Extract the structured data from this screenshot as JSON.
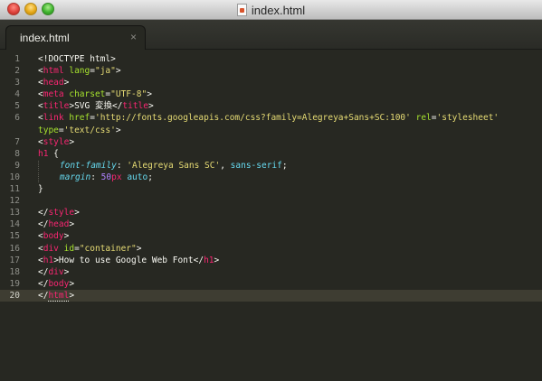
{
  "window": {
    "title": "index.html"
  },
  "tabs": [
    {
      "label": "index.html",
      "close_glyph": "×",
      "active": true
    }
  ],
  "editor": {
    "active_line": 20,
    "lines": [
      {
        "num": "1",
        "segs": [
          [
            "p",
            "<!DOCTYPE html>"
          ]
        ]
      },
      {
        "num": "2",
        "segs": [
          [
            "p",
            "<"
          ],
          [
            "g",
            "html"
          ],
          [
            "p",
            " "
          ],
          [
            "a",
            "lang"
          ],
          [
            "p",
            "="
          ],
          [
            "s",
            "\"ja\""
          ],
          [
            "p",
            ">"
          ]
        ]
      },
      {
        "num": "3",
        "segs": [
          [
            "p",
            "<"
          ],
          [
            "g",
            "head"
          ],
          [
            "p",
            ">"
          ]
        ]
      },
      {
        "num": "4",
        "segs": [
          [
            "p",
            "<"
          ],
          [
            "g",
            "meta"
          ],
          [
            "p",
            " "
          ],
          [
            "a",
            "charset"
          ],
          [
            "p",
            "="
          ],
          [
            "s",
            "\"UTF-8\""
          ],
          [
            "p",
            ">"
          ]
        ]
      },
      {
        "num": "5",
        "segs": [
          [
            "p",
            "<"
          ],
          [
            "g",
            "title"
          ],
          [
            "p",
            ">SVG 変換</"
          ],
          [
            "g",
            "title"
          ],
          [
            "p",
            ">"
          ]
        ]
      },
      {
        "num": "6",
        "segs": [
          [
            "p",
            "<"
          ],
          [
            "g",
            "link"
          ],
          [
            "p",
            " "
          ],
          [
            "a",
            "href"
          ],
          [
            "p",
            "="
          ],
          [
            "s",
            "'http://fonts.googleapis.com/css?family=Alegreya+Sans+SC:100'"
          ],
          [
            "p",
            " "
          ],
          [
            "a",
            "rel"
          ],
          [
            "p",
            "="
          ],
          [
            "s",
            "'stylesheet'"
          ]
        ]
      },
      {
        "num": "",
        "segs": [
          [
            "a",
            "type"
          ],
          [
            "p",
            "="
          ],
          [
            "s",
            "'text/css'"
          ],
          [
            "p",
            ">"
          ]
        ]
      },
      {
        "num": "7",
        "segs": [
          [
            "p",
            "<"
          ],
          [
            "g",
            "style"
          ],
          [
            "p",
            ">"
          ]
        ]
      },
      {
        "num": "8",
        "segs": [
          [
            "g",
            "h1"
          ],
          [
            "p",
            " {"
          ]
        ]
      },
      {
        "num": "9",
        "segs": [
          [
            "i",
            "    "
          ],
          [
            "k",
            "font-family"
          ],
          [
            "p",
            ": "
          ],
          [
            "s",
            "'Alegreya Sans SC'"
          ],
          [
            "p",
            ", "
          ],
          [
            "v",
            "sans-serif"
          ],
          [
            "p",
            ";"
          ]
        ]
      },
      {
        "num": "10",
        "segs": [
          [
            "i",
            "    "
          ],
          [
            "k",
            "margin"
          ],
          [
            "p",
            ": "
          ],
          [
            "n",
            "50"
          ],
          [
            "u",
            "px"
          ],
          [
            "p",
            " "
          ],
          [
            "v",
            "auto"
          ],
          [
            "p",
            ";"
          ]
        ]
      },
      {
        "num": "11",
        "segs": [
          [
            "p",
            "}"
          ]
        ]
      },
      {
        "num": "12",
        "segs": []
      },
      {
        "num": "13",
        "segs": [
          [
            "p",
            "</"
          ],
          [
            "g",
            "style"
          ],
          [
            "p",
            ">"
          ]
        ]
      },
      {
        "num": "14",
        "segs": [
          [
            "p",
            "</"
          ],
          [
            "g",
            "head"
          ],
          [
            "p",
            ">"
          ]
        ]
      },
      {
        "num": "15",
        "segs": [
          [
            "p",
            "<"
          ],
          [
            "g",
            "body"
          ],
          [
            "p",
            ">"
          ]
        ]
      },
      {
        "num": "16",
        "segs": [
          [
            "p",
            "<"
          ],
          [
            "g",
            "div"
          ],
          [
            "p",
            " "
          ],
          [
            "a",
            "id"
          ],
          [
            "p",
            "="
          ],
          [
            "s",
            "\"container\""
          ],
          [
            "p",
            ">"
          ]
        ]
      },
      {
        "num": "17",
        "segs": [
          [
            "p",
            "<"
          ],
          [
            "g",
            "h1"
          ],
          [
            "p",
            ">How to use Google Web Font</"
          ],
          [
            "g",
            "h1"
          ],
          [
            "p",
            ">"
          ]
        ]
      },
      {
        "num": "18",
        "segs": [
          [
            "p",
            "</"
          ],
          [
            "g",
            "div"
          ],
          [
            "p",
            ">"
          ]
        ]
      },
      {
        "num": "19",
        "segs": [
          [
            "p",
            "</"
          ],
          [
            "g",
            "body"
          ],
          [
            "p",
            ">"
          ]
        ]
      },
      {
        "num": "20",
        "segs": [
          [
            "p",
            "</"
          ],
          [
            "gu",
            "html"
          ],
          [
            "p",
            ">"
          ]
        ]
      }
    ]
  },
  "colors": {
    "background": "#272822",
    "tag": "#f92672",
    "attribute": "#a6e22e",
    "string": "#e6db74",
    "keyword": "#66d9ef",
    "number": "#ae81ff",
    "text": "#f8f8f2"
  }
}
